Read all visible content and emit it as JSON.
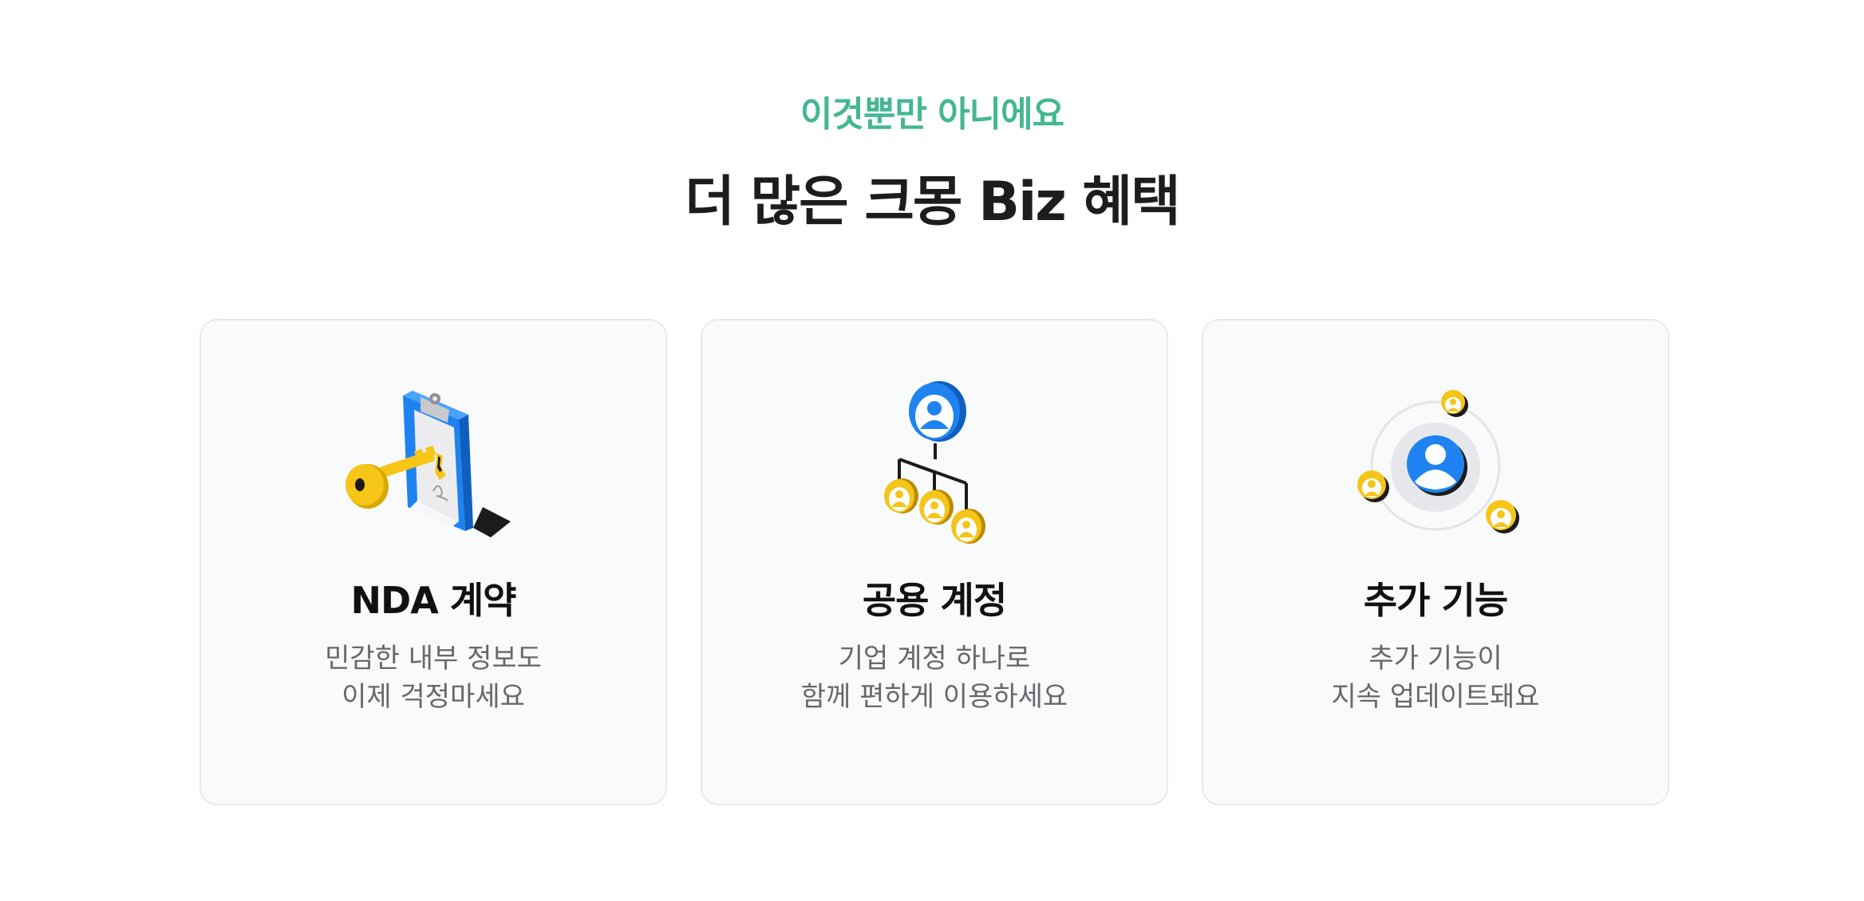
{
  "section": {
    "eyebrow": "이것뿐만 아니에요",
    "headline": "더 많은 크몽 Biz 혜택"
  },
  "cards": [
    {
      "icon": "clipboard-key-icon",
      "title": "NDA 계약",
      "desc_line1": "민감한 내부 정보도",
      "desc_line2": "이제 걱정마세요"
    },
    {
      "icon": "account-tree-icon",
      "title": "공용 계정",
      "desc_line1": "기업 계정 하나로",
      "desc_line2": "함께 편하게 이용하세요"
    },
    {
      "icon": "user-orbit-icon",
      "title": "추가 기능",
      "desc_line1": "추가 기능이",
      "desc_line2": "지속 업데이트돼요"
    }
  ],
  "colors": {
    "accent_green": "#44b792",
    "blue": "#1e83f0",
    "yellow": "#f5c518",
    "card_bg": "#f9fafc",
    "card_border": "#e8e9ec"
  }
}
